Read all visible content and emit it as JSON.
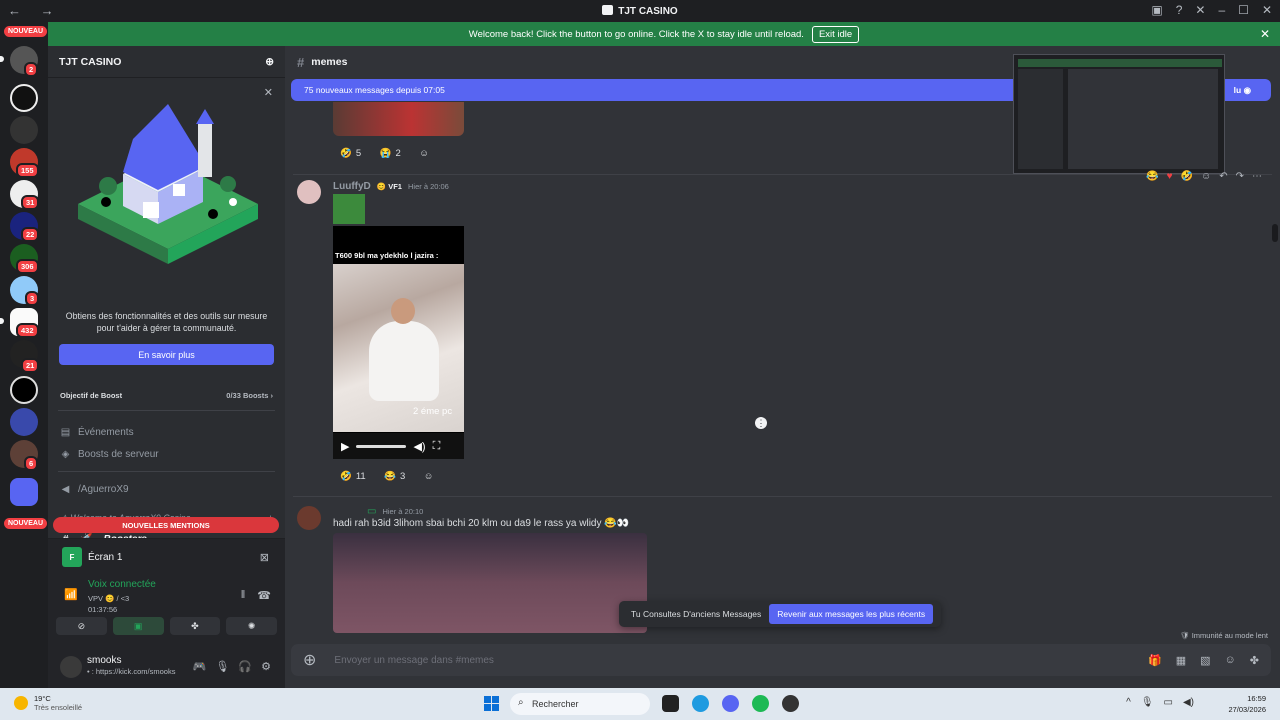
{
  "window": {
    "title": "TJT CASINO",
    "nav": "← →"
  },
  "banner": {
    "text": "Welcome back! Click the button to go online. Click the X to stay idle until reload.",
    "button": "Exit idle"
  },
  "rail": {
    "nouveau_top": "NOUVEAU",
    "nouveau_bottom": "NOUVEAU",
    "badges": [
      "2",
      "155",
      "31",
      "22",
      "306",
      "3",
      "432",
      "21",
      "6"
    ]
  },
  "sidebar": {
    "server_name": "TJT CASINO",
    "promo_text": "Obtiens des fonctionnalités et des outils sur mesure pour t'aider à gérer ta communauté.",
    "promo_button": "En savoir plus",
    "boost_goal_label": "Objectif de Boost",
    "boost_goal_value": "0/33 Boosts",
    "items": [
      {
        "label": "Événements",
        "icon": "calendar-icon"
      },
      {
        "label": "Boosts de serveur",
        "icon": "boost-icon"
      }
    ],
    "channel_aguerro": "/AguerroX9",
    "category": "Welcome to AguerroX9 Casino",
    "boosters_channel": "· Boosters",
    "mentions_pill": "NOUVELLES MENTIONS"
  },
  "voice": {
    "screen_title": "Écran 1",
    "status": "Voix connectée",
    "channel": "VPV 😊 / <3",
    "timer": "01:37:56"
  },
  "user": {
    "name": "smooks",
    "status": "• : https://kick.com/smooks"
  },
  "channel": {
    "name": "memes"
  },
  "new_messages": {
    "text": "75 nouveaux messages depuis 07:05",
    "right": "lu"
  },
  "messages": [
    {
      "reactions": [
        {
          "emoji": "🤣",
          "count": "5"
        },
        {
          "emoji": "😭",
          "count": "2"
        }
      ]
    },
    {
      "username": "LuuffyD",
      "tag": "VF1",
      "time": "Hier à 20:06",
      "video_caption": "T600 9bl ma ydekhlo l jazira :",
      "video_subtitle": "2 éme pc",
      "reactions": [
        {
          "emoji": "🤣",
          "count": "11"
        },
        {
          "emoji": "😂",
          "count": "3"
        }
      ]
    },
    {
      "username": "",
      "time": "Hier à 20:10",
      "text": "hadi rah b3id 3lihom sbai bchi 20 klm ou da9 le rass ya wlidy 😂👀"
    }
  ],
  "older_bar": {
    "text": "Tu Consultes D'anciens Messages",
    "button": "Revenir aux messages les plus récents"
  },
  "immunite": "Immunité au mode lent",
  "composer": {
    "placeholder": "Envoyer un message dans #memes"
  },
  "taskbar": {
    "temp": "19°C",
    "weather": "Très ensoleillé",
    "search": "Rechercher",
    "time": "16:59",
    "date": "27/03/2026"
  },
  "colors": {
    "blurple": "#5865f2",
    "green": "#248046",
    "red": "#f23f43",
    "bg_main": "#313338"
  }
}
